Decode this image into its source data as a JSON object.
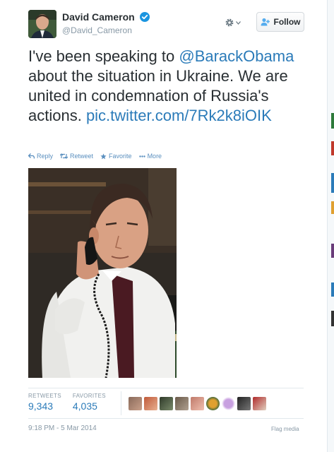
{
  "user": {
    "fullname": "David Cameron",
    "screenname": "@David_Cameron",
    "verified": true
  },
  "header": {
    "gear_icon": "gear-icon",
    "follow_label": "Follow"
  },
  "tweet": {
    "segments": [
      {
        "text": "I've been speaking to ",
        "link": false
      },
      {
        "text": "@BarackObama",
        "link": true
      },
      {
        "text": " about the situation in Ukraine. We are united in condemnation of Russia's actions. ",
        "link": false
      },
      {
        "text": "pic.twitter.com/7Rk2k8iOIK",
        "link": true
      }
    ]
  },
  "actions": {
    "reply": "Reply",
    "retweet": "Retweet",
    "favorite": "Favorite",
    "more": "More"
  },
  "stats": {
    "retweets_label": "RETWEETS",
    "retweets_value": "9,343",
    "favorites_label": "FAVORITES",
    "favorites_value": "4,035"
  },
  "favoriters": {
    "count": 10
  },
  "meta": {
    "timestamp": "9:18 PM - 5 Mar 2014",
    "flag_label": "Flag media"
  },
  "colors": {
    "link": "#2b7bb9",
    "text": "#292f33",
    "muted": "#8899a6",
    "verified": "#1b95e0"
  }
}
